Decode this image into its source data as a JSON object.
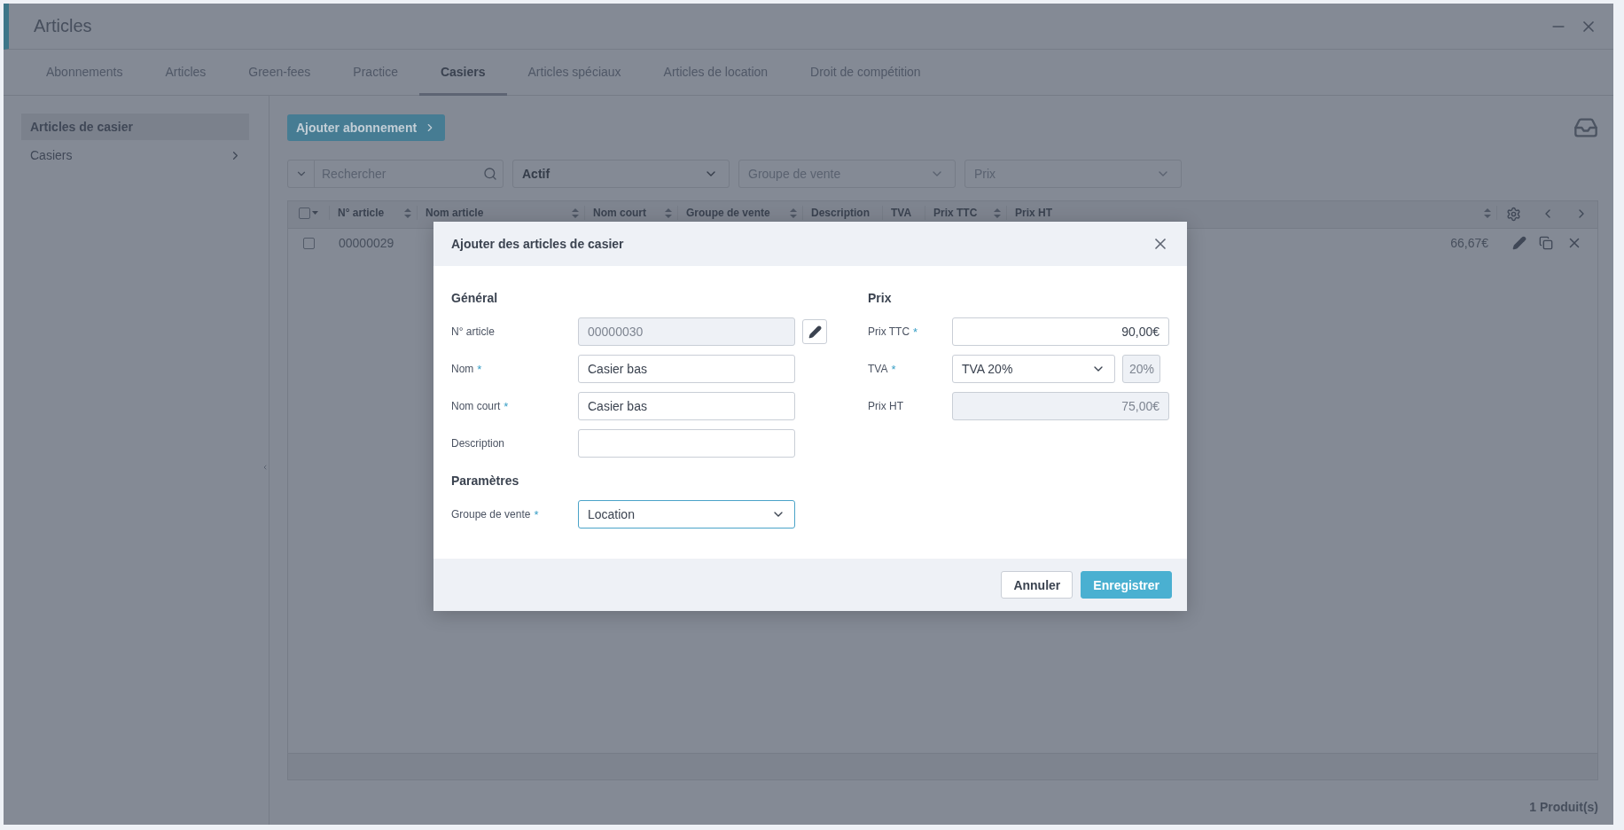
{
  "window": {
    "title": "Articles"
  },
  "tabs": [
    {
      "label": "Abonnements",
      "selected": false
    },
    {
      "label": "Articles",
      "selected": false
    },
    {
      "label": "Green-fees",
      "selected": false
    },
    {
      "label": "Practice",
      "selected": false
    },
    {
      "label": "Casiers",
      "selected": true
    },
    {
      "label": "Articles spéciaux",
      "selected": false
    },
    {
      "label": "Articles de location",
      "selected": false
    },
    {
      "label": "Droit de compétition",
      "selected": false
    }
  ],
  "sidebar": {
    "items": [
      {
        "label": "Articles de casier",
        "selected": true,
        "has_submenu": false
      },
      {
        "label": "Casiers",
        "selected": false,
        "has_submenu": true
      }
    ]
  },
  "toolbar": {
    "add_button": "Ajouter abonnement"
  },
  "filters": {
    "search": {
      "placeholder": "Rechercher"
    },
    "selects": [
      {
        "value": "Actif"
      },
      {
        "placeholder": "Groupe de vente"
      },
      {
        "placeholder": "Prix"
      }
    ]
  },
  "table": {
    "select_all_checked": false,
    "columns": [
      {
        "label": "N° article",
        "sortable": true
      },
      {
        "label": "Nom article",
        "sortable": true
      },
      {
        "label": "Nom court",
        "sortable": true
      },
      {
        "label": "Groupe de vente",
        "sortable": true
      },
      {
        "label": "Description",
        "sortable": false
      },
      {
        "label": "TVA",
        "sortable": false
      },
      {
        "label": "Prix TTC",
        "sortable": true
      },
      {
        "label": "Prix HT",
        "sortable": true
      }
    ],
    "rows": [
      {
        "checked": false,
        "article_no": "00000029",
        "price_ht": "66,67€"
      }
    ]
  },
  "footer": {
    "count": "1 Produit(s)"
  },
  "dialog": {
    "title": "Ajouter des articles de casier",
    "columns": [
      {
        "sections": [
          {
            "title": "Général",
            "fields": [
              {
                "label": "N° article",
                "kind": "text",
                "value": "00000030",
                "disabled": true,
                "edit_button": true
              },
              {
                "label": "Nom",
                "kind": "text",
                "required_mark": "*",
                "value": "Casier bas",
                "disabled": false
              },
              {
                "label": "Nom court",
                "kind": "text",
                "required_mark": "*",
                "value": "Casier bas",
                "disabled": false
              },
              {
                "label": "Description",
                "kind": "text",
                "disabled": false
              }
            ]
          },
          {
            "title": "Paramètres",
            "fields": [
              {
                "label": "Groupe de vente",
                "kind": "select",
                "required_mark": "*",
                "value": "Location",
                "focused": true
              }
            ]
          }
        ]
      },
      {
        "sections": [
          {
            "title": "Prix",
            "fields": [
              {
                "label": "Prix TTC",
                "kind": "text",
                "required_mark": "*",
                "value": "90,00€",
                "disabled": false,
                "numeric": true
              },
              {
                "label": "TVA",
                "kind": "select",
                "required_mark": "*",
                "value": "TVA 20%",
                "focused": false,
                "rate": "20%"
              },
              {
                "label": "Prix HT",
                "kind": "text",
                "value": "75,00€",
                "disabled": true,
                "numeric": true
              }
            ]
          }
        ]
      }
    ],
    "buttons": [
      {
        "label": "Annuler",
        "kind": "secondary"
      },
      {
        "label": "Enregistrer",
        "kind": "primary"
      }
    ]
  }
}
